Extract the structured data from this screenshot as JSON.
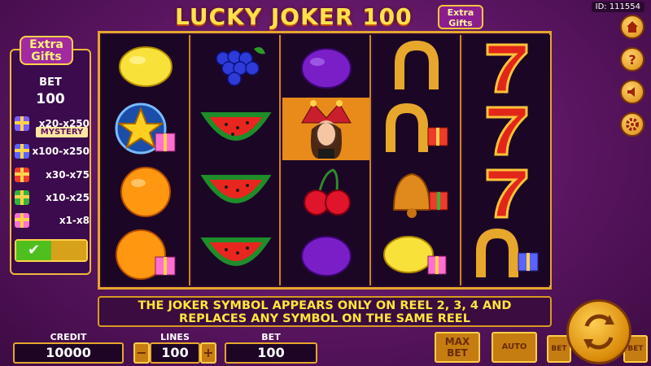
{
  "header": {
    "title_main": "LUCKY JOKER 100",
    "title_badge": "Extra Gifts",
    "game_id": "ID: 111554"
  },
  "side_panel": {
    "badge": "Extra Gifts",
    "bet_label": "BET",
    "bet_value": "100",
    "prizes": [
      {
        "range": "x20-x250",
        "icon": "mystery-gift-icon",
        "note": "MYSTERY",
        "color": "#7b5cff"
      },
      {
        "range": "x100-x250",
        "icon": "blue-gift-icon",
        "color": "#5a62ff"
      },
      {
        "range": "x30-x75",
        "icon": "red-gift-icon",
        "color": "#ef3b2a"
      },
      {
        "range": "x10-x25",
        "icon": "green-gift-icon",
        "color": "#36b43a"
      },
      {
        "range": "x1-x8",
        "icon": "pink-gift-icon",
        "color": "#ff6fd1"
      }
    ],
    "toggle_check": "✔"
  },
  "reels": [
    [
      "lemon",
      "star-gift",
      "orange",
      "orange-gift"
    ],
    [
      "grapes",
      "watermelon",
      "watermelon",
      "watermelon"
    ],
    [
      "plum",
      "joker",
      "cherries",
      "plum"
    ],
    [
      "horseshoe",
      "horseshoe-gift",
      "bell-gift",
      "lemon-gift"
    ],
    [
      "seven",
      "seven",
      "seven",
      "horseshoe-gift"
    ]
  ],
  "message": {
    "line1": "THE JOKER SYMBOL APPEARS ONLY ON REEL 2, 3, 4 AND",
    "line2": "REPLACES ANY SYMBOL ON THE SAME REEL"
  },
  "controls": {
    "credit_label": "CREDIT",
    "credit_value": "10000",
    "lines_label": "LINES",
    "lines_value": "100",
    "lines_minus": "−",
    "lines_plus": "+",
    "bet_label": "BET",
    "bet_value": "100",
    "max_bet": "MAX BET",
    "auto": "AUTO",
    "bet_minus": "BET",
    "bet_plus": "BET"
  },
  "side_buttons": [
    {
      "name": "home",
      "icon": "home-icon"
    },
    {
      "name": "help",
      "icon": "question-icon",
      "label": "?"
    },
    {
      "name": "sound",
      "icon": "speaker-icon"
    },
    {
      "name": "settings",
      "icon": "gear-icon"
    }
  ],
  "colors": {
    "accent_gold": "#e5a52c",
    "message_text": "#ffe63c",
    "background": "#5a1560"
  }
}
